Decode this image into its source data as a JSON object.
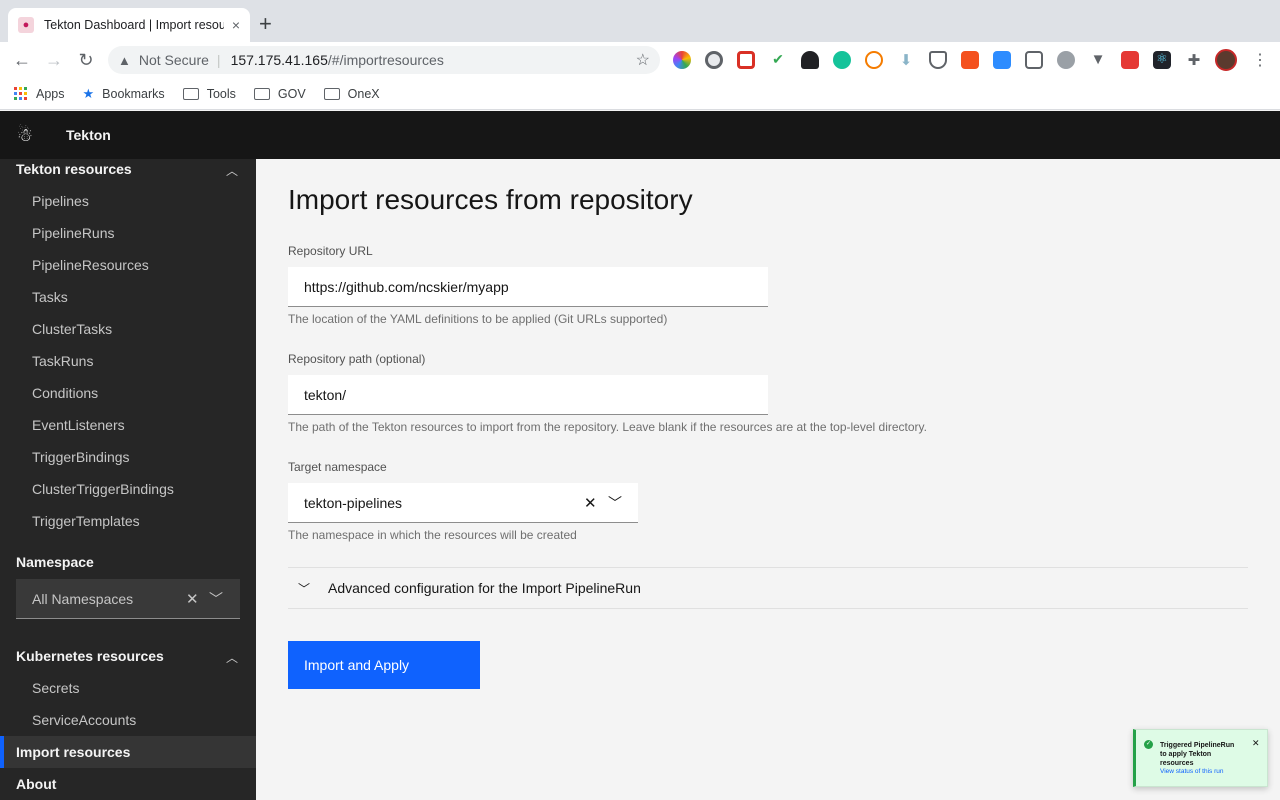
{
  "browser": {
    "tab_title": "Tekton Dashboard | Import resources",
    "tab_close": "×",
    "new_tab": "+",
    "security_label": "Not Secure",
    "url_host": "157.175.41.165",
    "url_rest": "/#/importresources"
  },
  "bookmarks": {
    "items": [
      "Apps",
      "Bookmarks",
      "Tools",
      "GOV",
      "OneX"
    ]
  },
  "app": {
    "title": "Tekton"
  },
  "sidebar": {
    "tekton_section": "Tekton resources",
    "tekton_items": [
      "Pipelines",
      "PipelineRuns",
      "PipelineResources",
      "Tasks",
      "ClusterTasks",
      "TaskRuns",
      "Conditions",
      "EventListeners",
      "TriggerBindings",
      "ClusterTriggerBindings",
      "TriggerTemplates"
    ],
    "namespace_label": "Namespace",
    "namespace_value": "All Namespaces",
    "k8s_section": "Kubernetes resources",
    "k8s_items": [
      "Secrets",
      "ServiceAccounts"
    ],
    "import_link": "Import resources",
    "about_link": "About"
  },
  "main": {
    "title": "Import resources from repository",
    "repo_url_label": "Repository URL",
    "repo_url_value": "https://github.com/ncskier/myapp",
    "repo_url_helper": "The location of the YAML definitions to be applied (Git URLs supported)",
    "repo_path_label": "Repository path (optional)",
    "repo_path_value": "tekton/",
    "repo_path_helper": "The path of the Tekton resources to import from the repository. Leave blank if the resources are at the top-level directory.",
    "namespace_label": "Target namespace",
    "namespace_value": "tekton-pipelines",
    "namespace_helper": "The namespace in which the resources will be created",
    "advanced_label": "Advanced configuration for the Import PipelineRun",
    "import_button": "Import and Apply"
  },
  "toast": {
    "title": "Triggered PipelineRun to apply Tekton resources",
    "link": "View status of this run"
  },
  "colors": {
    "primary": "#0f62fe",
    "header_bg": "#161616",
    "sidebar_bg": "#262626",
    "success": "#24a148"
  }
}
